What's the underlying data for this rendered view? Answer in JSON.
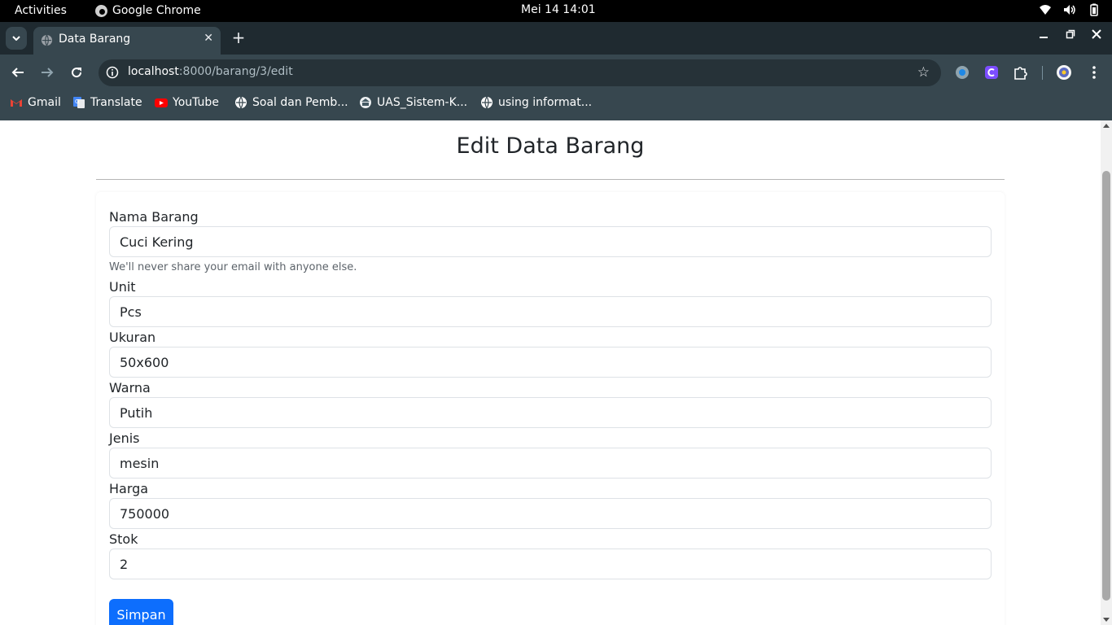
{
  "os_bar": {
    "activities": "Activities",
    "app_name": "Google Chrome",
    "datetime": "Mei 14  14:01"
  },
  "browser": {
    "tab_title": "Data Barang",
    "url_host": "localhost",
    "url_rest": ":8000/barang/3/edit",
    "bookmarks": [
      {
        "label": "Gmail",
        "icon": "gmail-icon"
      },
      {
        "label": "Translate",
        "icon": "translate-icon"
      },
      {
        "label": "YouTube",
        "icon": "youtube-icon"
      },
      {
        "label": "Soal dan Pemb...",
        "icon": "globe-icon"
      },
      {
        "label": "UAS_Sistem-K...",
        "icon": "university-icon"
      },
      {
        "label": "using informat...",
        "icon": "globe-icon"
      }
    ]
  },
  "page": {
    "title": "Edit Data Barang",
    "fields": [
      {
        "label": "Nama Barang",
        "value": "Cuci Kering"
      },
      {
        "label": "Unit",
        "value": "Pcs"
      },
      {
        "label": "Ukuran",
        "value": "50x600"
      },
      {
        "label": "Warna",
        "value": "Putih"
      },
      {
        "label": "Jenis",
        "value": "mesin"
      },
      {
        "label": "Harga",
        "value": "750000"
      },
      {
        "label": "Stok",
        "value": "2"
      }
    ],
    "help_text": "We'll never share your email with anyone else.",
    "submit_label": "Simpan"
  },
  "colors": {
    "primary": "#0d6efd",
    "browser_frame": "#37474f"
  }
}
